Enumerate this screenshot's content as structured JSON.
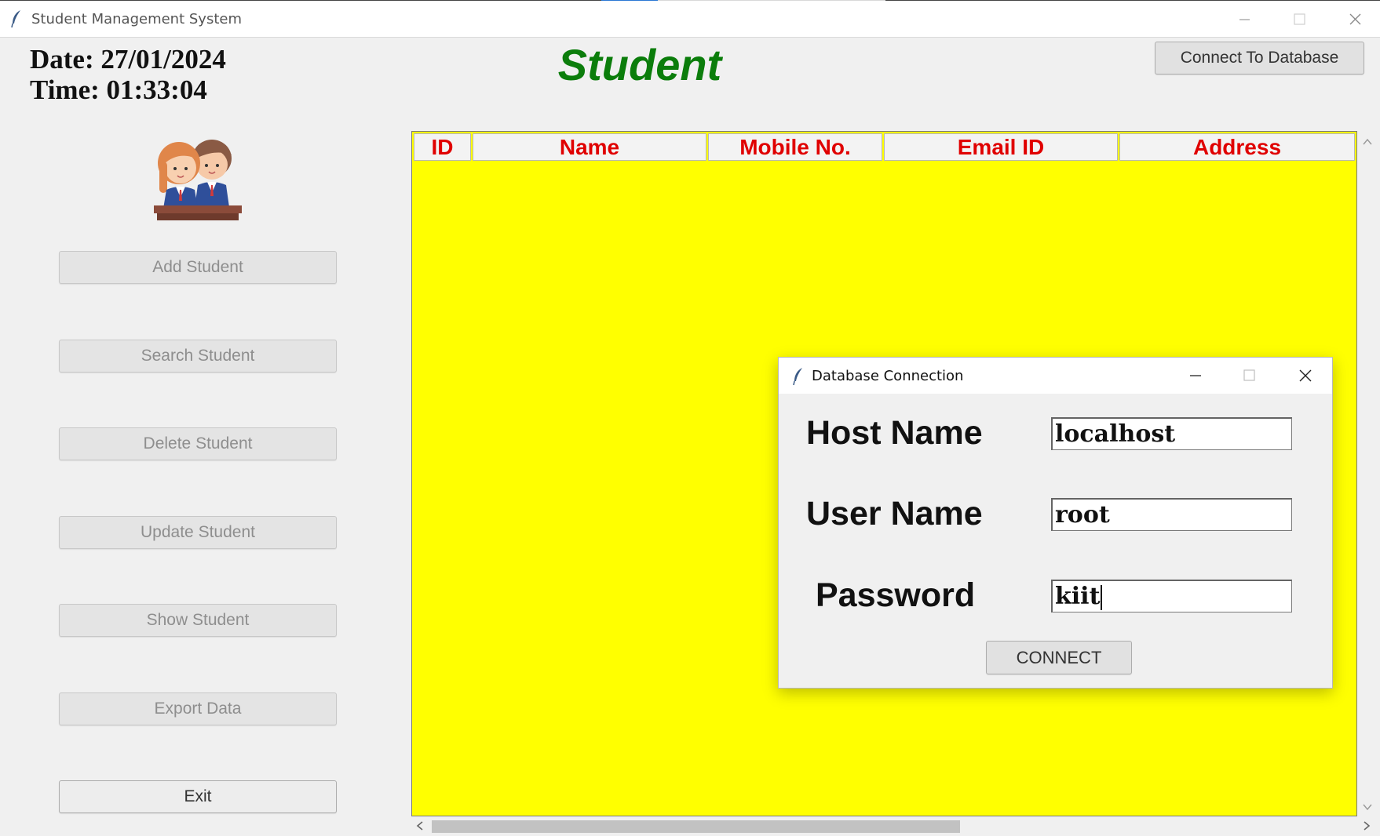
{
  "window": {
    "title": "Student Management System"
  },
  "header": {
    "date_label": "Date: 27/01/2024",
    "time_label": "Time: 01:33:04",
    "app_title": "Student",
    "connect_button": "Connect To Database"
  },
  "sidebar": {
    "buttons": [
      {
        "label": "Add Student",
        "enabled": false
      },
      {
        "label": "Search Student",
        "enabled": false
      },
      {
        "label": "Delete Student",
        "enabled": false
      },
      {
        "label": "Update Student",
        "enabled": false
      },
      {
        "label": "Show Student",
        "enabled": false
      },
      {
        "label": "Export Data",
        "enabled": false
      },
      {
        "label": "Exit",
        "enabled": true
      }
    ]
  },
  "table": {
    "columns": [
      "ID",
      "Name",
      "Mobile No.",
      "Email ID",
      "Address"
    ],
    "rows": [],
    "background": "#ffff00",
    "header_color": "#e00000"
  },
  "dialog": {
    "title": "Database Connection",
    "host_label": "Host Name",
    "host_value": "localhost",
    "user_label": "User Name",
    "user_value": "root",
    "password_label": "Password",
    "password_value": "kiit",
    "connect_button": "CONNECT"
  },
  "colors": {
    "title_green": "#0b7d0b",
    "window_bg": "#f0f0f0"
  }
}
